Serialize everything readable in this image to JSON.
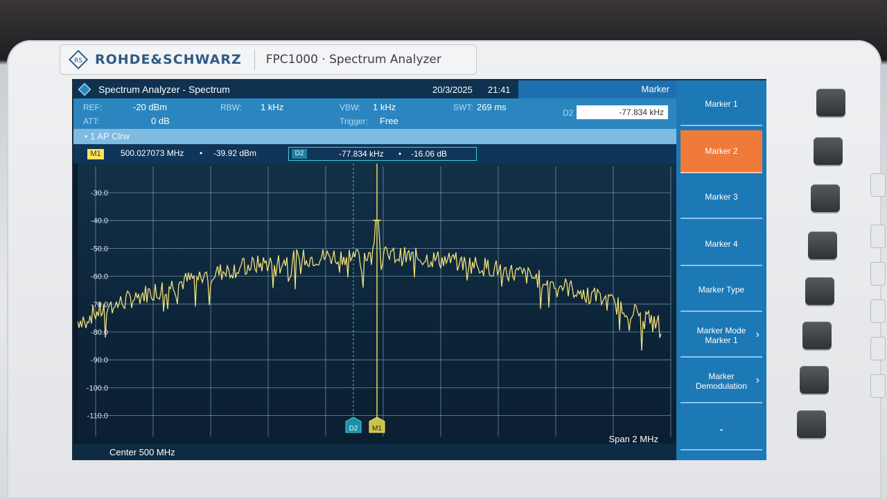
{
  "device": {
    "brand": "ROHDE&SCHWARZ",
    "model": "FPC1000 · Spectrum Analyzer"
  },
  "header": {
    "title": "Spectrum Analyzer - Spectrum",
    "date": "20/3/2025",
    "time": "21:41",
    "menu_title": "Marker"
  },
  "params": {
    "ref_label": "REF:",
    "ref_value": "-20 dBm",
    "att_label": "ATT:",
    "att_value": "0 dB",
    "rbw_label": "RBW:",
    "rbw_value": "1 kHz",
    "vbw_label": "VBW:",
    "vbw_value": "1 kHz",
    "trigger_label": "Trigger:",
    "trigger_value": "Free",
    "swt_label": "SWT:",
    "swt_value": "269 ms",
    "d2_label": "D2",
    "d2_input": "-77.834 kHz"
  },
  "trace": {
    "label": "• 1 AP Clrw"
  },
  "markers": {
    "m1_tag": "M1",
    "m1_freq": "500.027073 MHz",
    "m1_level": "-39.92 dBm",
    "bullet": "•",
    "d2_tag": "D2",
    "d2_freq": "-77.834 kHz",
    "d2_level": "-16.06 dB"
  },
  "plot": {
    "y_labels": [
      "-30.0",
      "-40.0",
      "-50.0",
      "-60.0",
      "-70.0",
      "-80.0",
      "-90.0",
      "-100.0",
      "-110.0"
    ],
    "marker_tags": [
      "D2",
      "M1"
    ],
    "trace_color": "#f2e07a",
    "grid_color": "#8fb1c8",
    "m1_color": "#f7e65c",
    "d2_color": "#3fd1d6"
  },
  "footer": {
    "center": "Center 500 MHz",
    "span": "Span 2 MHz"
  },
  "softkeys": [
    {
      "label": "Marker 1",
      "active": false,
      "chevron": ""
    },
    {
      "label": "Marker 2",
      "active": true,
      "chevron": ""
    },
    {
      "label": "Marker 3",
      "active": false,
      "chevron": ""
    },
    {
      "label": "Marker 4",
      "active": false,
      "chevron": ""
    },
    {
      "label": "Marker Type",
      "active": false,
      "chevron": ""
    },
    {
      "label": "Marker Mode Marker 1",
      "active": false,
      "chevron": "›"
    },
    {
      "label": "Marker Demodulation",
      "active": false,
      "chevron": "›"
    },
    {
      "label": "⌄",
      "active": false,
      "chevron": ""
    }
  ]
}
